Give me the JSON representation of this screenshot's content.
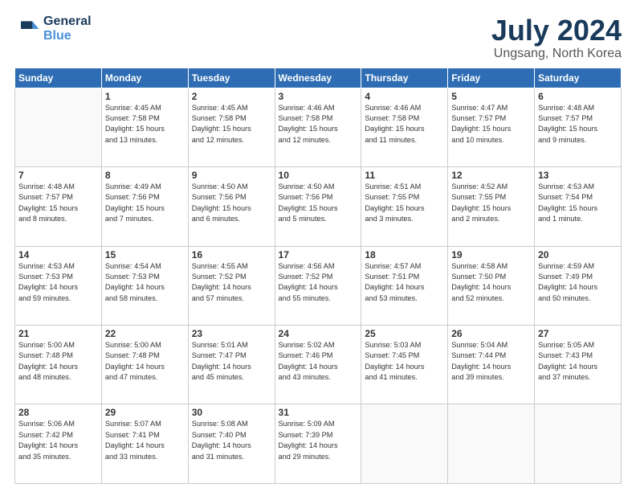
{
  "logo": {
    "line1": "General",
    "line2": "Blue"
  },
  "title": "July 2024",
  "location": "Ungsang, North Korea",
  "weekdays": [
    "Sunday",
    "Monday",
    "Tuesday",
    "Wednesday",
    "Thursday",
    "Friday",
    "Saturday"
  ],
  "days": [
    {
      "date": "",
      "info": ""
    },
    {
      "date": "1",
      "info": "Sunrise: 4:45 AM\nSunset: 7:58 PM\nDaylight: 15 hours\nand 13 minutes."
    },
    {
      "date": "2",
      "info": "Sunrise: 4:45 AM\nSunset: 7:58 PM\nDaylight: 15 hours\nand 12 minutes."
    },
    {
      "date": "3",
      "info": "Sunrise: 4:46 AM\nSunset: 7:58 PM\nDaylight: 15 hours\nand 12 minutes."
    },
    {
      "date": "4",
      "info": "Sunrise: 4:46 AM\nSunset: 7:58 PM\nDaylight: 15 hours\nand 11 minutes."
    },
    {
      "date": "5",
      "info": "Sunrise: 4:47 AM\nSunset: 7:57 PM\nDaylight: 15 hours\nand 10 minutes."
    },
    {
      "date": "6",
      "info": "Sunrise: 4:48 AM\nSunset: 7:57 PM\nDaylight: 15 hours\nand 9 minutes."
    },
    {
      "date": "7",
      "info": "Sunrise: 4:48 AM\nSunset: 7:57 PM\nDaylight: 15 hours\nand 8 minutes."
    },
    {
      "date": "8",
      "info": "Sunrise: 4:49 AM\nSunset: 7:56 PM\nDaylight: 15 hours\nand 7 minutes."
    },
    {
      "date": "9",
      "info": "Sunrise: 4:50 AM\nSunset: 7:56 PM\nDaylight: 15 hours\nand 6 minutes."
    },
    {
      "date": "10",
      "info": "Sunrise: 4:50 AM\nSunset: 7:56 PM\nDaylight: 15 hours\nand 5 minutes."
    },
    {
      "date": "11",
      "info": "Sunrise: 4:51 AM\nSunset: 7:55 PM\nDaylight: 15 hours\nand 3 minutes."
    },
    {
      "date": "12",
      "info": "Sunrise: 4:52 AM\nSunset: 7:55 PM\nDaylight: 15 hours\nand 2 minutes."
    },
    {
      "date": "13",
      "info": "Sunrise: 4:53 AM\nSunset: 7:54 PM\nDaylight: 15 hours\nand 1 minute."
    },
    {
      "date": "14",
      "info": "Sunrise: 4:53 AM\nSunset: 7:53 PM\nDaylight: 14 hours\nand 59 minutes."
    },
    {
      "date": "15",
      "info": "Sunrise: 4:54 AM\nSunset: 7:53 PM\nDaylight: 14 hours\nand 58 minutes."
    },
    {
      "date": "16",
      "info": "Sunrise: 4:55 AM\nSunset: 7:52 PM\nDaylight: 14 hours\nand 57 minutes."
    },
    {
      "date": "17",
      "info": "Sunrise: 4:56 AM\nSunset: 7:52 PM\nDaylight: 14 hours\nand 55 minutes."
    },
    {
      "date": "18",
      "info": "Sunrise: 4:57 AM\nSunset: 7:51 PM\nDaylight: 14 hours\nand 53 minutes."
    },
    {
      "date": "19",
      "info": "Sunrise: 4:58 AM\nSunset: 7:50 PM\nDaylight: 14 hours\nand 52 minutes."
    },
    {
      "date": "20",
      "info": "Sunrise: 4:59 AM\nSunset: 7:49 PM\nDaylight: 14 hours\nand 50 minutes."
    },
    {
      "date": "21",
      "info": "Sunrise: 5:00 AM\nSunset: 7:48 PM\nDaylight: 14 hours\nand 48 minutes."
    },
    {
      "date": "22",
      "info": "Sunrise: 5:00 AM\nSunset: 7:48 PM\nDaylight: 14 hours\nand 47 minutes."
    },
    {
      "date": "23",
      "info": "Sunrise: 5:01 AM\nSunset: 7:47 PM\nDaylight: 14 hours\nand 45 minutes."
    },
    {
      "date": "24",
      "info": "Sunrise: 5:02 AM\nSunset: 7:46 PM\nDaylight: 14 hours\nand 43 minutes."
    },
    {
      "date": "25",
      "info": "Sunrise: 5:03 AM\nSunset: 7:45 PM\nDaylight: 14 hours\nand 41 minutes."
    },
    {
      "date": "26",
      "info": "Sunrise: 5:04 AM\nSunset: 7:44 PM\nDaylight: 14 hours\nand 39 minutes."
    },
    {
      "date": "27",
      "info": "Sunrise: 5:05 AM\nSunset: 7:43 PM\nDaylight: 14 hours\nand 37 minutes."
    },
    {
      "date": "28",
      "info": "Sunrise: 5:06 AM\nSunset: 7:42 PM\nDaylight: 14 hours\nand 35 minutes."
    },
    {
      "date": "29",
      "info": "Sunrise: 5:07 AM\nSunset: 7:41 PM\nDaylight: 14 hours\nand 33 minutes."
    },
    {
      "date": "30",
      "info": "Sunrise: 5:08 AM\nSunset: 7:40 PM\nDaylight: 14 hours\nand 31 minutes."
    },
    {
      "date": "31",
      "info": "Sunrise: 5:09 AM\nSunset: 7:39 PM\nDaylight: 14 hours\nand 29 minutes."
    },
    {
      "date": "",
      "info": ""
    },
    {
      "date": "",
      "info": ""
    },
    {
      "date": "",
      "info": ""
    },
    {
      "date": "",
      "info": ""
    }
  ]
}
